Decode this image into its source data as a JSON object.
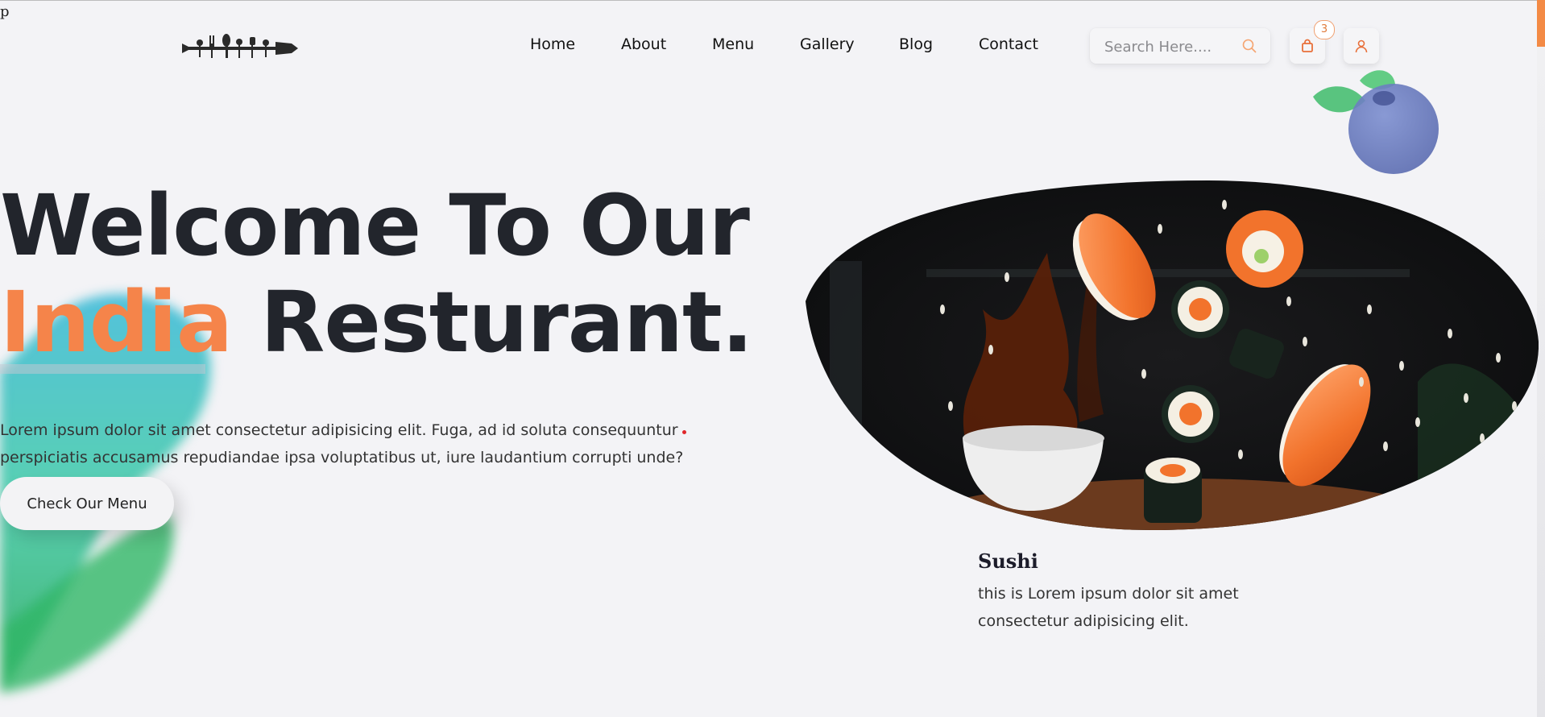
{
  "stray_text": "p",
  "header": {
    "nav": [
      {
        "label": "Home"
      },
      {
        "label": "About"
      },
      {
        "label": "Menu"
      },
      {
        "label": "Gallery"
      },
      {
        "label": "Blog"
      },
      {
        "label": "Contact"
      }
    ],
    "search": {
      "placeholder": "Search Here...."
    },
    "cart_count": "3"
  },
  "hero": {
    "line1": "Welcome To Our",
    "highlight": "India",
    "line2_rest": "Resturant.",
    "description": "Lorem ipsum dolor sit amet consectetur adipisicing elit. Fuga, ad id soluta consequuntur perspiciatis accusamus repudiandae ipsa voluptatibus ut, iure laudantium corrupti unde?",
    "cta_label": "Check Our Menu"
  },
  "featured": {
    "title": "Sushi",
    "description": "this is Lorem ipsum dolor sit amet consectetur adipisicing elit."
  },
  "colors": {
    "accent": "#f5844a",
    "background": "#f3f3f6",
    "text": "#22252c"
  },
  "icons": [
    "logo-icon",
    "search-icon",
    "cart-icon",
    "user-icon",
    "blueberry-decoration",
    "leaf-decoration"
  ]
}
